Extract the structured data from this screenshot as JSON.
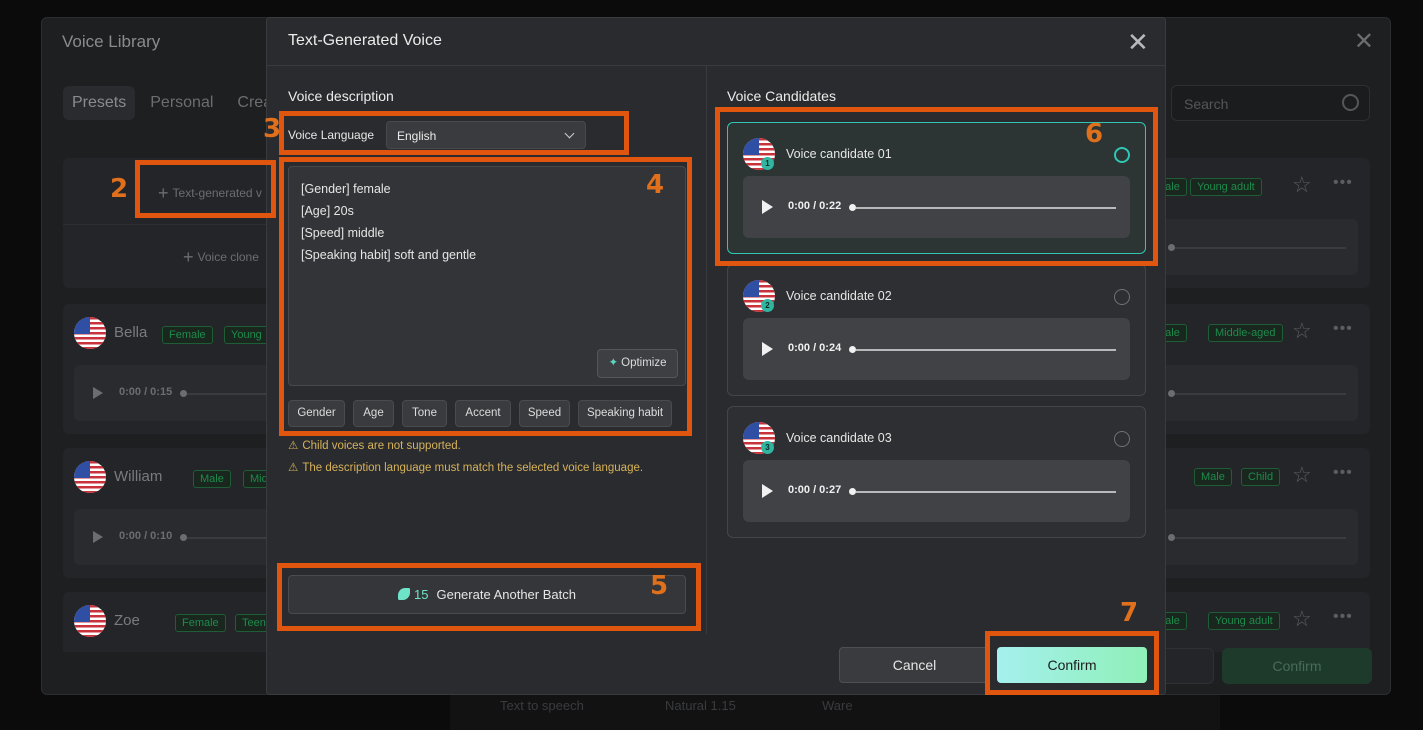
{
  "library": {
    "title": "Voice Library",
    "tabs": [
      "Presets",
      "Personal",
      "Crea"
    ],
    "search_placeholder": "Search",
    "create": {
      "text_generated": "Text-generated v",
      "voice_clone": "Voice clone"
    },
    "voices": [
      {
        "name": "Bella",
        "tags": [
          "Female",
          "Young"
        ],
        "time": "0:00 / 0:15",
        "right_tags": [
          "male",
          "Middle-aged"
        ]
      },
      {
        "name": "William",
        "tags": [
          "Male",
          "Middle-"
        ],
        "time": "0:00 / 0:10",
        "right_tags": [
          "Male",
          "Child"
        ]
      },
      {
        "name": "Zoe",
        "tags": [
          "Female",
          "Teen"
        ],
        "right_tags": [
          "male",
          "Young adult"
        ]
      }
    ],
    "first_right_tags": [
      "Male",
      "Young adult"
    ],
    "confirm_label": "Confirm",
    "bottom_bar": [
      "Text to speech",
      "Natural 1.15",
      "Ware"
    ]
  },
  "modal": {
    "title": "Text-Generated Voice",
    "voice_description_title": "Voice description",
    "voice_language_label": "Voice Language",
    "voice_language_value": "English",
    "description_lines": [
      "[Gender] female",
      "[Age] 20s",
      "[Speed] middle",
      "[Speaking habit] soft and gentle"
    ],
    "optimize_label": "Optimize",
    "chips": [
      "Gender",
      "Age",
      "Tone",
      "Accent",
      "Speed",
      "Speaking habit"
    ],
    "warnings": [
      "Child voices are not supported.",
      "The description language must match the selected voice language."
    ],
    "generate": {
      "credits": "15",
      "label": "Generate Another Batch"
    },
    "candidates_title": "Voice Candidates",
    "candidates": [
      {
        "name": "Voice candidate 01",
        "num": "1",
        "time": "0:00 / 0:22",
        "selected": true
      },
      {
        "name": "Voice candidate 02",
        "num": "2",
        "time": "0:00 / 0:24",
        "selected": false
      },
      {
        "name": "Voice candidate 03",
        "num": "3",
        "time": "0:00 / 0:27",
        "selected": false
      }
    ],
    "cancel_label": "Cancel",
    "confirm_label": "Confirm"
  },
  "annotations": [
    "2",
    "3",
    "4",
    "5",
    "6",
    "7"
  ],
  "colors": {
    "accent": "#2fc7b4",
    "annotation": "#e0560f",
    "tag_green": "#1f8a4c",
    "warning": "#d6b25a"
  },
  "icons": {
    "close": "close-icon",
    "play": "play-icon",
    "flag": "us-flag-icon",
    "star": "star-icon",
    "more": "more-icon",
    "search": "search-icon",
    "optimize": "sparkle-icon",
    "credits": "leaf-icon",
    "warning": "warning-icon"
  }
}
